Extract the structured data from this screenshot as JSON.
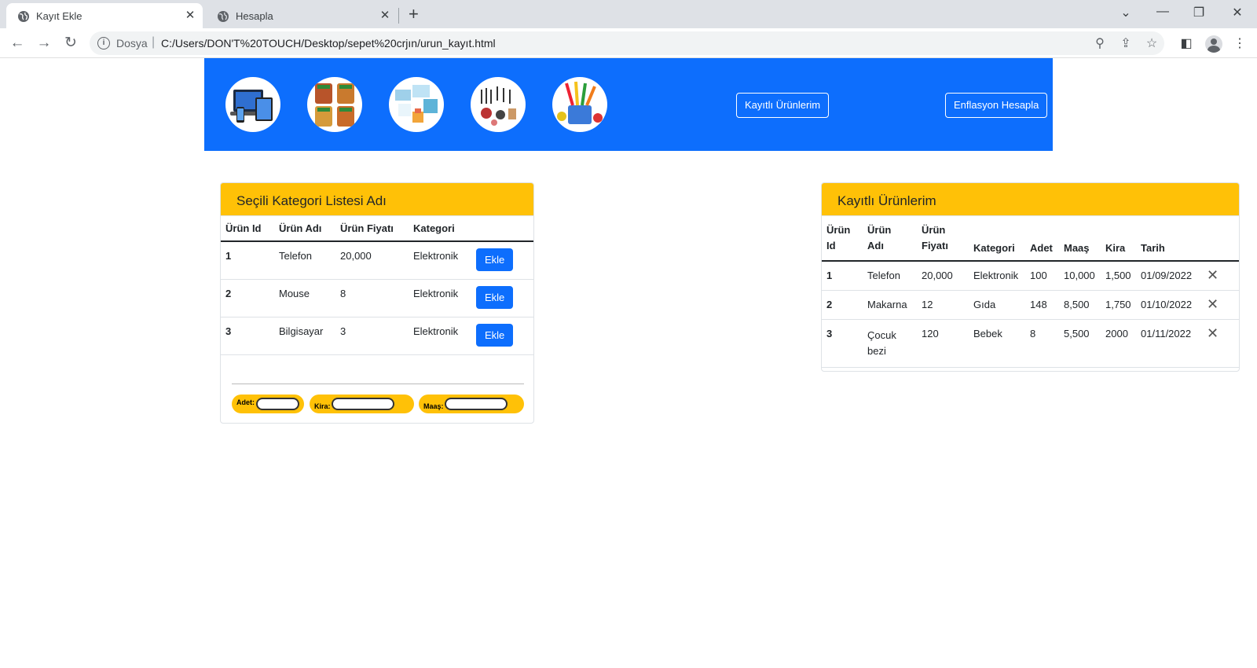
{
  "browser": {
    "tabs": [
      {
        "title": "Kayıt Ekle",
        "active": true
      },
      {
        "title": "Hesapla",
        "active": false
      }
    ],
    "address": {
      "security_label": "Dosya",
      "url": "C:/Users/DON'T%20TOUCH/Desktop/sepet%20crjın/urun_kayıt.html"
    }
  },
  "hero": {
    "categories": [
      "electronics",
      "food",
      "baby",
      "cosmetics",
      "stationery"
    ],
    "saved_button": "Kayıtlı Ürünlerim",
    "inflation_button": "Enflasyon Hesapla",
    "color": "#0d6efd"
  },
  "category_card": {
    "title": "Seçili Kategori Listesi Adı",
    "headers": [
      "Ürün Id",
      "Ürün Adı",
      "Ürün Fiyatı",
      "Kategori"
    ],
    "add_label": "Ekle",
    "rows": [
      {
        "id": "1",
        "name": "Telefon",
        "price": "20,000",
        "category": "Elektronik"
      },
      {
        "id": "2",
        "name": "Mouse",
        "price": "8",
        "category": "Elektronik"
      },
      {
        "id": "3",
        "name": "Bilgisayar",
        "price": "3",
        "category": "Elektronik"
      }
    ],
    "calc": {
      "adet_label": "Adet:",
      "kira_label": "Kira:",
      "maas_label": "Maaş:"
    }
  },
  "saved_card": {
    "title": "Kayıtlı Ürünlerim",
    "headers": {
      "id_1": "Ürün",
      "id_2": "Id",
      "name_1": "Ürün",
      "name_2": "Adı",
      "price_1": "Ürün",
      "price_2": "Fiyatı",
      "category": "Kategori",
      "adet": "Adet",
      "maas": "Maaş",
      "kira": "Kira",
      "tarih": "Tarih"
    },
    "rows": [
      {
        "id": "1",
        "name": "Telefon",
        "price": "20,000",
        "category": "Elektronik",
        "adet": "100",
        "maas": "10,000",
        "kira": "1,500",
        "tarih": "01/09/2022"
      },
      {
        "id": "2",
        "name": "Makarna",
        "price": "12",
        "category": "Gıda",
        "adet": "148",
        "maas": "8,500",
        "kira": "1,750",
        "tarih": "01/10/2022"
      },
      {
        "id": "3",
        "name": "Çocuk bezi",
        "price": "120",
        "category": "Bebek",
        "adet": "8",
        "maas": "5,500",
        "kira": "2000",
        "tarih": "01/11/2022"
      }
    ]
  },
  "colors": {
    "accent": "#0d6efd",
    "header_yellow": "#ffc107"
  }
}
